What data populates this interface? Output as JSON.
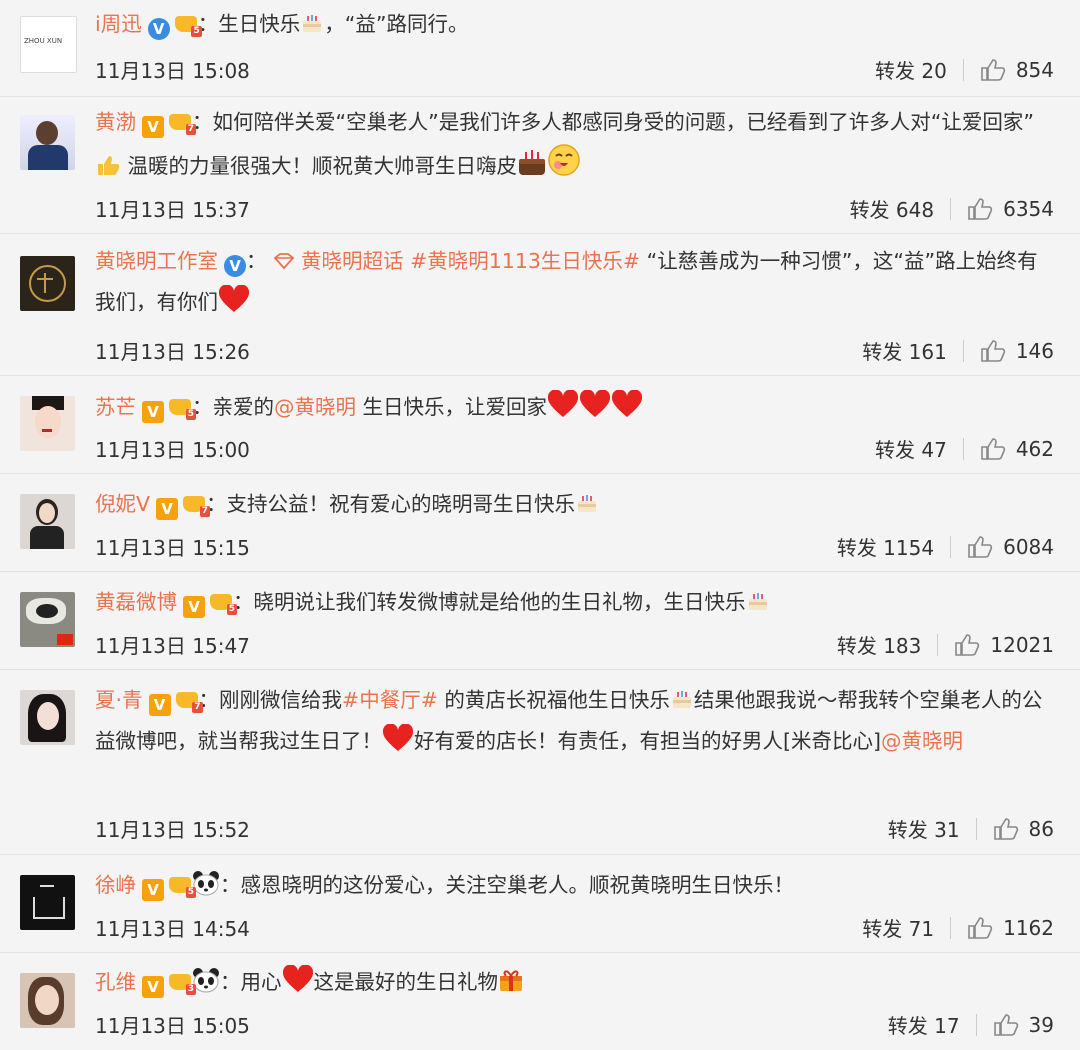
{
  "comments": [
    {
      "user": "i周迅",
      "verify": "V",
      "level": "5",
      "text_parts": [
        "：生日快乐",
        "，“益”路同行。"
      ],
      "time": "11月13日 15:08",
      "repost": "转发 20",
      "likes": "854"
    },
    {
      "user": "黄渤",
      "verify": "V",
      "level": "7",
      "text_parts": [
        "：如何陪伴关爱“空巢老人”是我们许多人都感同身受的问题，已经看到了许多人对“让爱回家”",
        "温暖的力量很强大！顺祝黄大帅哥生日嗨皮"
      ],
      "time": "11月13日 15:37",
      "repost": "转发 648",
      "likes": "6354"
    },
    {
      "user": "黄晓明工作室",
      "verify": "V",
      "supertopic": "黄晓明超话",
      "hashtag": "#黄晓明1113生日快乐#",
      "text_parts": [
        "“让慈善成为一种习惯”，这“益”路上始终有我们，有你们"
      ],
      "time": "11月13日 15:26",
      "repost": "转发 161",
      "likes": "146"
    },
    {
      "user": "苏芒",
      "verify": "V",
      "level": "5",
      "mention": "@黄晓明",
      "text_parts": [
        "：亲爱的",
        " 生日快乐，让爱回家"
      ],
      "time": "11月13日 15:00",
      "repost": "转发 47",
      "likes": "462"
    },
    {
      "user": "倪妮V",
      "verify": "V",
      "level": "7",
      "text_parts": [
        "：支持公益！祝有爱心的晓明哥生日快乐"
      ],
      "time": "11月13日 15:15",
      "repost": "转发 1154",
      "likes": "6084"
    },
    {
      "user": "黄磊微博",
      "verify": "V",
      "level": "5",
      "text_parts": [
        "：晓明说让我们转发微博就是给他的生日礼物，生日快乐"
      ],
      "time": "11月13日 15:47",
      "repost": "转发 183",
      "likes": "12021"
    },
    {
      "user": "夏·青",
      "verify": "V",
      "level": "7",
      "hashtag": "#中餐厅#",
      "mention": "@黄晓明",
      "text_parts": [
        "：刚刚微信给我",
        " 的黄店长祝福他生日快乐",
        "结果他跟我说～帮我转个空巢老人的公益微博吧，就当帮我过生日了！",
        "好有爱的店长！有责任，有担当的好男人[米奇比心]"
      ],
      "time": "11月13日 15:52",
      "repost": "转发 31",
      "likes": "86"
    },
    {
      "user": "徐峥",
      "verify": "V",
      "level": "5",
      "text_parts": [
        "：感恩晓明的这份爱心，关注空巢老人。顺祝黄晓明生日快乐！"
      ],
      "time": "11月13日 14:54",
      "repost": "转发 71",
      "likes": "1162"
    },
    {
      "user": "孔维",
      "verify": "V",
      "level": "3",
      "text_parts": [
        "：用心",
        "这是最好的生日礼物"
      ],
      "time": "11月13日 15:05",
      "repost": "转发 17",
      "likes": "39"
    }
  ],
  "avatars": [
    {
      "label": "ZHOU XUN"
    },
    {
      "label": ""
    },
    {
      "label": ""
    },
    {
      "label": ""
    },
    {
      "label": ""
    },
    {
      "label": ""
    },
    {
      "label": ""
    },
    {
      "label": ""
    },
    {
      "label": ""
    }
  ],
  "colors": {
    "name": "#eb7350",
    "background": "#f4f4f4",
    "verify_blue": "#3a8ce2",
    "verify_gold": "#f7a20c"
  },
  "icons": [
    "cake-emoji",
    "thumbs-up-emoji",
    "heart-emoji",
    "panda-emoji",
    "gift-emoji",
    "thumb-up-icon",
    "supertopic-icon"
  ]
}
